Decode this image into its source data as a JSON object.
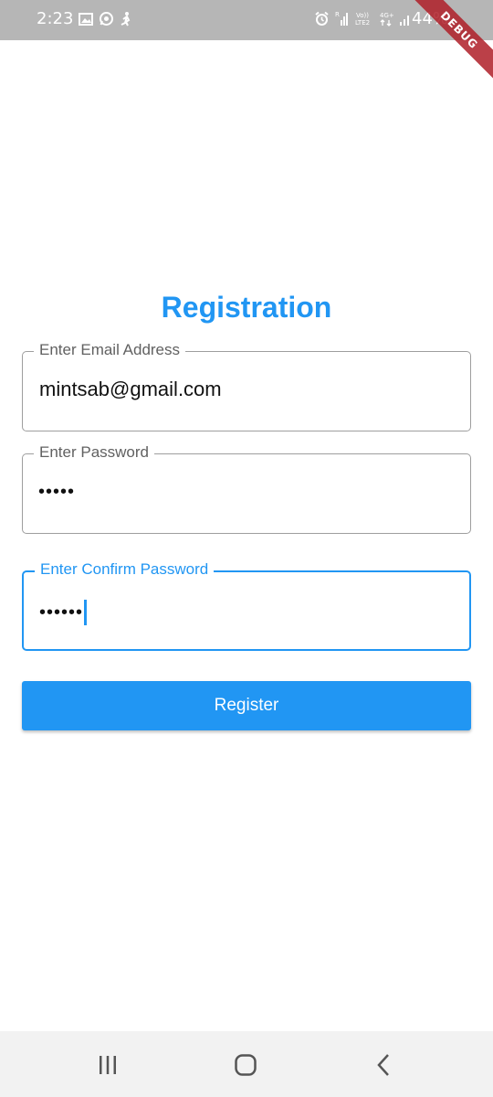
{
  "status_bar": {
    "time": "2:23",
    "battery": "44%",
    "left_icons": [
      "image-icon",
      "whatsapp-icon",
      "runner-icon"
    ],
    "right_icons": [
      "alarm-icon",
      "signal-icon",
      "volte-icon",
      "network-4g-icon",
      "signal2-icon",
      "battery-icon"
    ]
  },
  "debug_banner": "DEBUG",
  "title": "Registration",
  "form": {
    "email": {
      "label": "Enter Email Address",
      "value": "mintsab@gmail.com"
    },
    "password": {
      "label": "Enter Password",
      "value": "•••••"
    },
    "confirm_password": {
      "label": "Enter Confirm Password",
      "value": "••••••"
    },
    "register_label": "Register"
  },
  "colors": {
    "accent": "#2196f3",
    "status_bar": "#b6b6b6",
    "nav_bar": "#f2f2f2",
    "border": "#9e9e9e"
  },
  "nav_bar": {
    "icons": [
      "recent-apps-icon",
      "home-icon",
      "back-icon"
    ]
  }
}
